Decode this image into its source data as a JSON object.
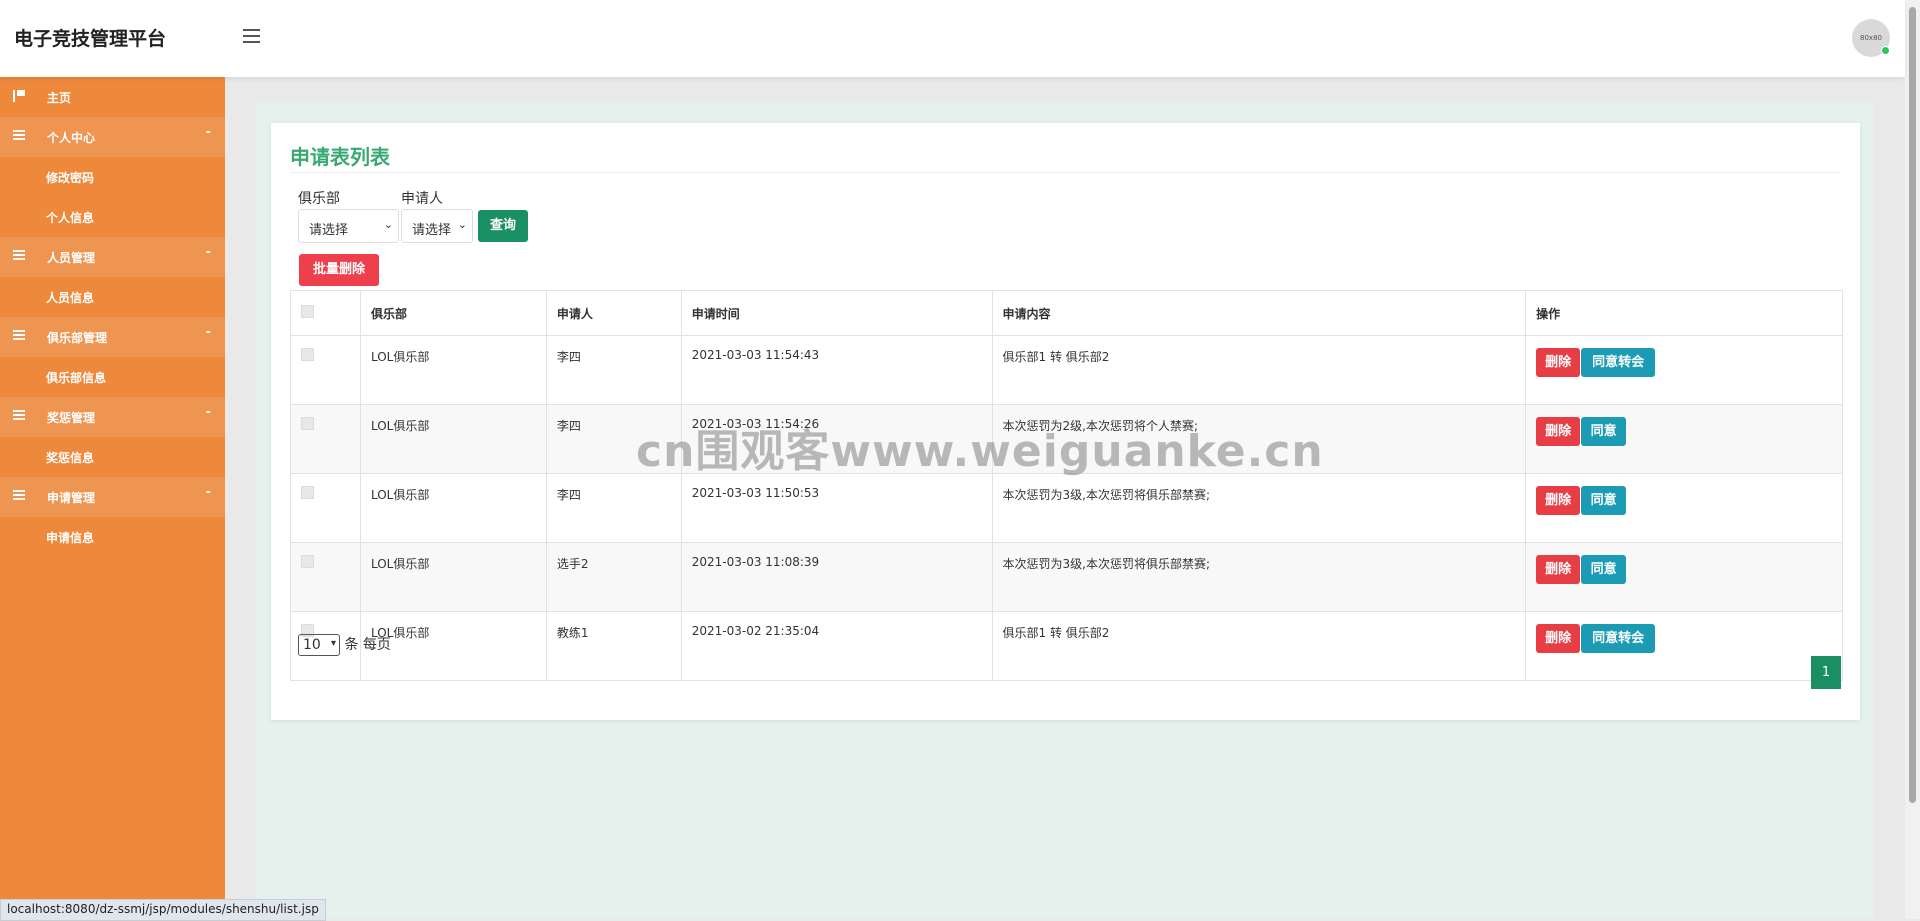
{
  "header": {
    "title": "电子竞技管理平台",
    "avatar_text": "80x80"
  },
  "sidebar": {
    "home": "主页",
    "groups": [
      {
        "label": "个人中心",
        "caret": "-",
        "items": [
          "修改密码",
          "个人信息"
        ]
      },
      {
        "label": "人员管理",
        "caret": "-",
        "items": [
          "人员信息"
        ]
      },
      {
        "label": "俱乐部管理",
        "caret": "-",
        "items": [
          "俱乐部信息"
        ]
      },
      {
        "label": "奖惩管理",
        "caret": "-",
        "items": [
          "奖惩信息"
        ]
      },
      {
        "label": "申请管理",
        "caret": "-",
        "items": [
          "申请信息"
        ]
      }
    ]
  },
  "page": {
    "title": "申请表列表",
    "filters": {
      "club_label": "俱乐部",
      "club_value": "请选择",
      "applicant_label": "申请人",
      "applicant_value": "请选择",
      "query_button": "查询"
    },
    "batch_delete_button": "批量删除",
    "table": {
      "headers": [
        "俱乐部",
        "申请人",
        "申请时间",
        "申请内容",
        "操作"
      ],
      "rows": [
        {
          "club": "LOL俱乐部",
          "applicant": "李四",
          "time": "2021-03-03 11:54:43",
          "content": "俱乐部1 转 俱乐部2",
          "delete": "删除",
          "action": "同意转会"
        },
        {
          "club": "LOL俱乐部",
          "applicant": "李四",
          "time": "2021-03-03 11:54:26",
          "content": "本次惩罚为2级,本次惩罚将个人禁赛;",
          "delete": "删除",
          "action": "同意"
        },
        {
          "club": "LOL俱乐部",
          "applicant": "李四",
          "time": "2021-03-03 11:50:53",
          "content": "本次惩罚为3级,本次惩罚将俱乐部禁赛;",
          "delete": "删除",
          "action": "同意"
        },
        {
          "club": "LOL俱乐部",
          "applicant": "选手2",
          "time": "2021-03-03 11:08:39",
          "content": "本次惩罚为3级,本次惩罚将俱乐部禁赛;",
          "delete": "删除",
          "action": "同意"
        },
        {
          "club": "LOL俱乐部",
          "applicant": "教练1",
          "time": "2021-03-02 21:35:04",
          "content": "俱乐部1 转 俱乐部2",
          "delete": "删除",
          "action": "同意转会"
        }
      ]
    },
    "pagination": {
      "per_page": "10",
      "per_page_suffix": "条 每页",
      "current_page": "1"
    }
  },
  "status_url": "localhost:8080/dz-ssmj/jsp/modules/shenshu/list.jsp",
  "watermark": "cn围观客www.weiguanke.cn",
  "colors": {
    "sidebar": "#ee883b",
    "sidebar_group": "#ef9552",
    "title_green": "#39a973",
    "primary": "#1a8f63",
    "danger": "#e73e46",
    "info": "#1c9cb4"
  }
}
